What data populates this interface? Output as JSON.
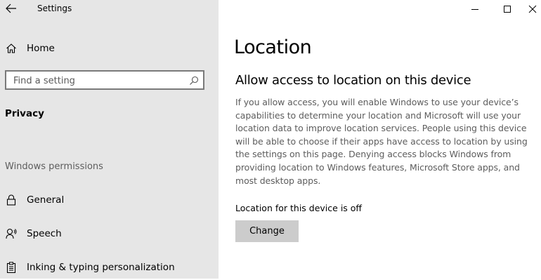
{
  "window": {
    "app_title": "Settings"
  },
  "sidebar": {
    "home_label": "Home",
    "search_placeholder": "Find a setting",
    "section_label": "Privacy",
    "group_label": "Windows permissions",
    "items": [
      {
        "label": "General",
        "icon": "lock-icon"
      },
      {
        "label": "Speech",
        "icon": "speech-icon"
      },
      {
        "label": "Inking & typing personalization",
        "icon": "clipboard-icon"
      }
    ]
  },
  "main": {
    "page_title": "Location",
    "subtitle": "Allow access to location on this device",
    "description": "If you allow access, you will enable Windows to use your device’s capabilities to determine your location and Microsoft will use your location data to improve location services. People using this device will be able to choose if their apps have access to location by using the settings on this page. Denying access blocks Windows from providing location to Windows features, Microsoft Store apps, and most desktop apps.",
    "status_text": "Location for this device is off",
    "change_button": "Change"
  },
  "colors": {
    "sidebar_bg": "#e6e6e6",
    "main_bg": "#ffffff",
    "button_bg": "#cccccc",
    "description_text": "#5d5d5d"
  }
}
